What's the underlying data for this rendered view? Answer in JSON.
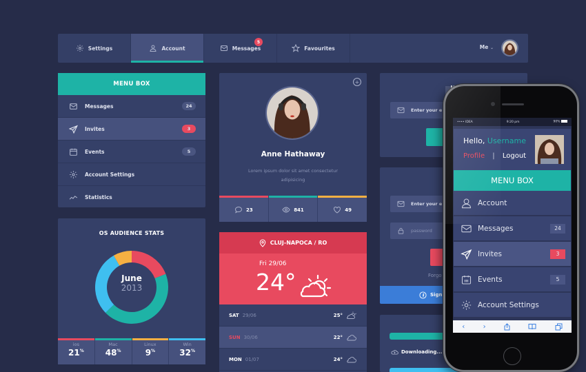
{
  "topnav": {
    "tabs": [
      {
        "label": "Settings",
        "icon": "gear-icon"
      },
      {
        "label": "Account",
        "icon": "user-icon",
        "active": true
      },
      {
        "label": "Messages",
        "icon": "envelope-icon",
        "badge": "5"
      },
      {
        "label": "Favourites",
        "icon": "star-icon"
      }
    ],
    "user_menu_label": "Me"
  },
  "menu_box": {
    "title": "MENU BOX",
    "items": [
      {
        "label": "Messages",
        "icon": "envelope-icon",
        "count": "24"
      },
      {
        "label": "Invites",
        "icon": "paper-plane-icon",
        "count": "3",
        "active": true
      },
      {
        "label": "Events",
        "icon": "calendar-icon",
        "count": "5"
      },
      {
        "label": "Account Settings",
        "icon": "gear-icon"
      },
      {
        "label": "Statistics",
        "icon": "chart-line-icon"
      }
    ]
  },
  "os_stats": {
    "title": "OS AUDIENCE STATS",
    "center_month": "June",
    "center_year": "2013",
    "legend": [
      {
        "name": "ios",
        "value": "21",
        "unit": "%",
        "color": "#e84a5f"
      },
      {
        "name": "Mac",
        "value": "48",
        "unit": "%",
        "color": "#1eb3a6"
      },
      {
        "name": "Linux",
        "value": "9",
        "unit": "%",
        "color": "#f6b042"
      },
      {
        "name": "Win",
        "value": "32",
        "unit": "%",
        "color": "#3fbff0"
      }
    ]
  },
  "chart_data": {
    "type": "pie",
    "title": "OS AUDIENCE STATS",
    "subtitle": "June 2013",
    "categories": [
      "ios",
      "Mac",
      "Linux",
      "Win"
    ],
    "values": [
      21,
      48,
      9,
      32
    ],
    "colors": [
      "#e84a5f",
      "#1eb3a6",
      "#f6b042",
      "#3fbff0"
    ],
    "donut": true,
    "legend": "bottom"
  },
  "profile": {
    "name": "Anne Hathaway",
    "description": "Lorem ipsum dolor sit amet consectetur adipisicing",
    "stats": [
      {
        "icon": "comment-icon",
        "value": "23",
        "color": "#e84a5f"
      },
      {
        "icon": "eye-icon",
        "value": "841",
        "color": "#1eb3a6"
      },
      {
        "icon": "heart-icon",
        "value": "49",
        "color": "#f6b042"
      }
    ]
  },
  "weather": {
    "location": "CLUJ-NAPOCA / RO",
    "today_date": "Fri 29/06",
    "today_temp": "24°",
    "forecast": [
      {
        "day": "SAT",
        "date": "29/06",
        "temp": "25°",
        "icon": "partly-sunny-icon"
      },
      {
        "day": "SUN",
        "date": "30/06",
        "temp": "22°",
        "icon": "cloud-icon"
      },
      {
        "day": "MON",
        "date": "01/07",
        "temp": "24°",
        "icon": "cloud-icon"
      }
    ]
  },
  "join": {
    "title": "JOIN THE N",
    "email_placeholder": "Enter your e"
  },
  "signin": {
    "title": "SIGN IN TO",
    "email_placeholder": "Enter your e",
    "password_placeholder": "password",
    "forgot": "Forgo",
    "facebook_label": "Sign"
  },
  "download": {
    "label": "Downloading...",
    "bars": [
      {
        "color": "#1eb3a6"
      },
      {
        "color": "#3fbff0"
      }
    ]
  },
  "phone": {
    "status": {
      "carrier": "•••• IDEA",
      "time": "9:20 pm",
      "battery": "90%"
    },
    "hello_prefix": "Hello,",
    "username": "Username",
    "profile_link": "Profile",
    "separator": "|",
    "logout_link": "Logout",
    "menu_title": "MENU BOX",
    "items": [
      {
        "label": "Account",
        "icon": "user-icon"
      },
      {
        "label": "Messages",
        "icon": "envelope-icon",
        "count": "24"
      },
      {
        "label": "Invites",
        "icon": "paper-plane-icon",
        "count": "3",
        "active": true
      },
      {
        "label": "Events",
        "icon": "calendar-icon",
        "count": "5"
      },
      {
        "label": "Account Settings",
        "icon": "gear-icon"
      }
    ],
    "safari": {
      "back": "‹",
      "forward": "›"
    }
  }
}
